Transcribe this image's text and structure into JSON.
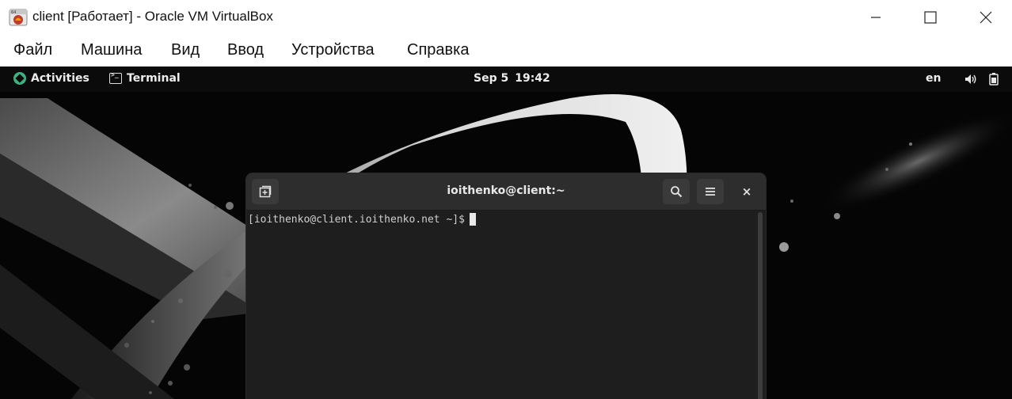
{
  "window": {
    "title": "client [Работает] - Oracle VM VirtualBox",
    "minimize_glyph": "—",
    "maximize_glyph": "☐",
    "close_glyph": "✕"
  },
  "menubar": {
    "items": [
      "Файл",
      "Машина",
      "Вид",
      "Ввод",
      "Устройства",
      "Справка"
    ]
  },
  "guest": {
    "topbar": {
      "activities_label": "Activities",
      "app_label": "Terminal",
      "date": "Sep 5",
      "time": "19:42",
      "language": "en",
      "volume_icon": "volume-icon",
      "battery_icon": "battery-icon"
    },
    "terminal": {
      "title": "ioithenko@client:~",
      "prompt": "[ioithenko@client.ioithenko.net ~]$",
      "close_glyph": "×",
      "icons": [
        "new-tab-icon",
        "search-icon",
        "hamburger-menu-icon",
        "close-icon"
      ]
    }
  },
  "colors": {
    "topbar_bg": "#0b0b0b",
    "terminal_header": "#2d2d2d",
    "terminal_bg": "#1e1e1e",
    "activities_logo": "#3fb37f"
  }
}
